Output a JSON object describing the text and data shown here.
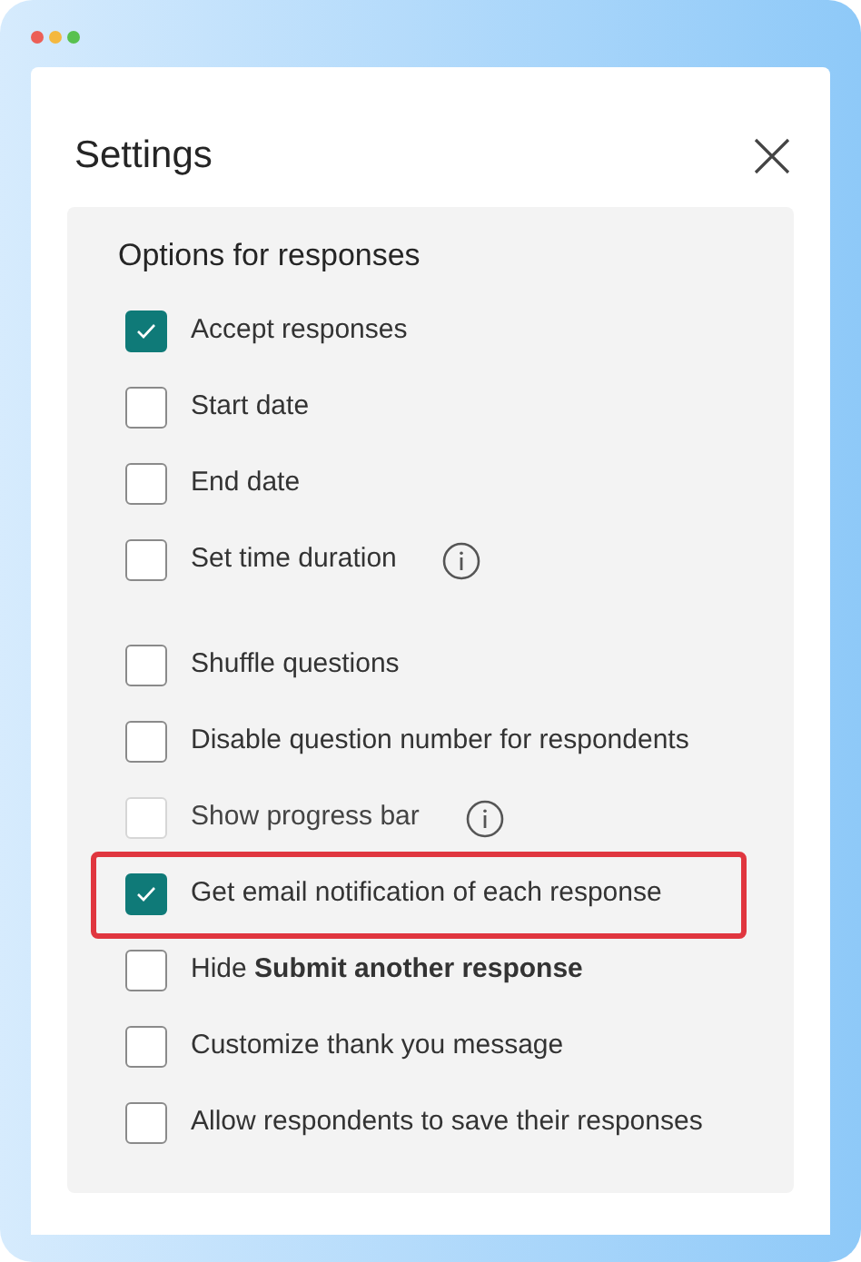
{
  "window": {
    "title": "Settings"
  },
  "section": {
    "heading": "Options for responses",
    "groups": [
      [
        {
          "label": "Accept responses",
          "checked": true,
          "disabled": false,
          "info": false,
          "highlighted": false
        },
        {
          "label": "Start date",
          "checked": false,
          "disabled": false,
          "info": false,
          "highlighted": false
        },
        {
          "label": "End date",
          "checked": false,
          "disabled": false,
          "info": false,
          "highlighted": false
        },
        {
          "label": "Set time duration",
          "checked": false,
          "disabled": false,
          "info": true,
          "highlighted": false
        }
      ],
      [
        {
          "label": "Shuffle questions",
          "checked": false,
          "disabled": false,
          "info": false,
          "highlighted": false
        },
        {
          "label": "Disable question number for respondents",
          "checked": false,
          "disabled": false,
          "info": false,
          "highlighted": false
        },
        {
          "label": "Show progress bar",
          "checked": false,
          "disabled": true,
          "info": true,
          "highlighted": false
        },
        {
          "label": "Get email notification of each response",
          "checked": true,
          "disabled": false,
          "info": false,
          "highlighted": true
        },
        {
          "label": "Hide **Submit another response**",
          "checked": false,
          "disabled": false,
          "info": false,
          "highlighted": false
        },
        {
          "label": "Customize thank you message",
          "checked": false,
          "disabled": false,
          "info": false,
          "highlighted": false
        },
        {
          "label": "Allow respondents to save their responses",
          "checked": false,
          "disabled": false,
          "info": false,
          "highlighted": false
        }
      ]
    ]
  }
}
